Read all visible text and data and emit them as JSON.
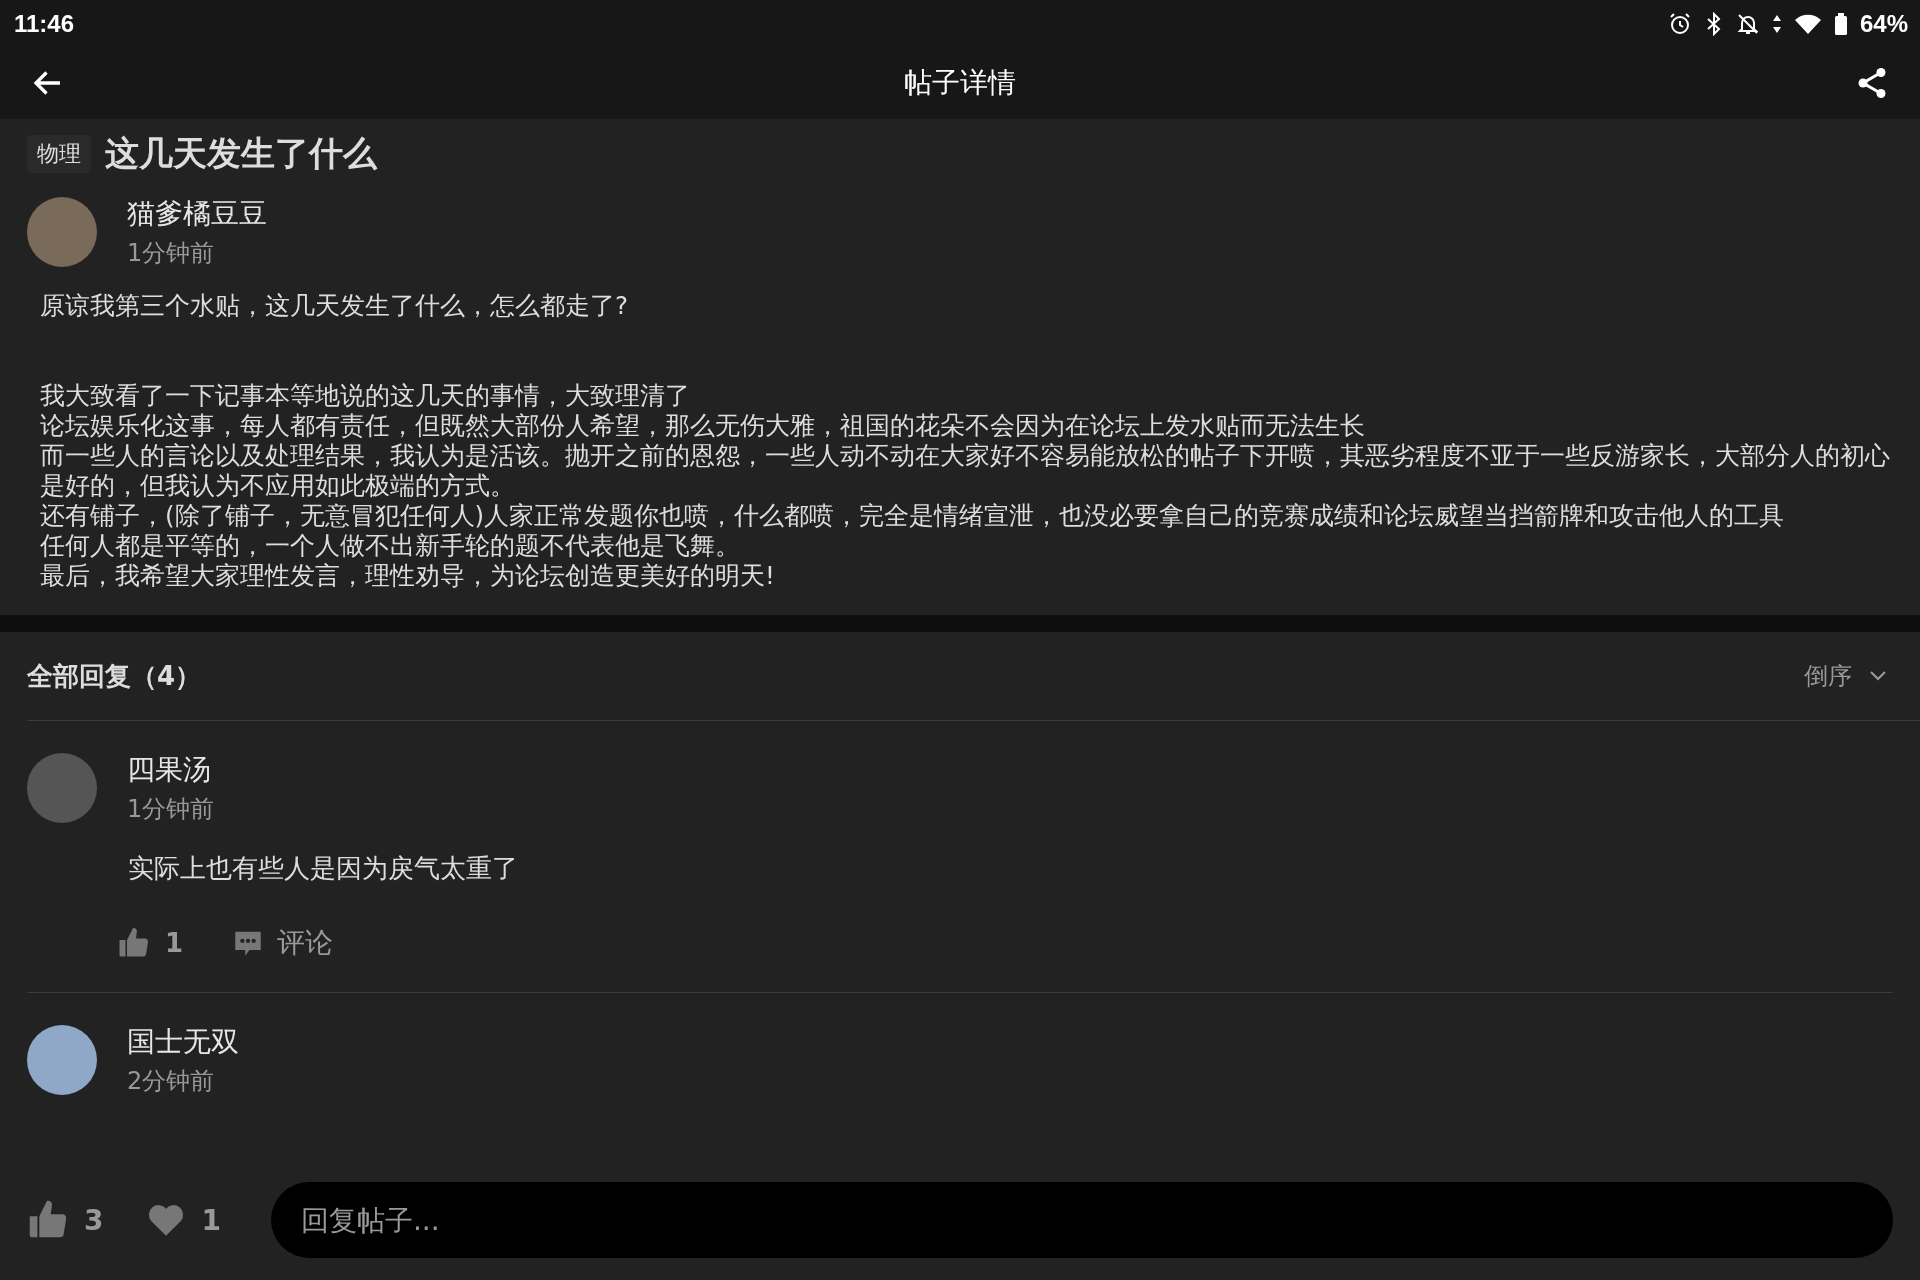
{
  "status_bar": {
    "time": "11:46",
    "battery": "64%"
  },
  "header": {
    "title": "帖子详情"
  },
  "post": {
    "tag": "物理",
    "title": "这几天发生了什么",
    "author": "猫爹橘豆豆",
    "time": "1分钟前",
    "body": [
      "原谅我第三个水贴，这几天发生了什么，怎么都走了?",
      "我大致看了一下记事本等地说的这几天的事情，大致理清了",
      "论坛娱乐化这事，每人都有责任，但既然大部份人希望，那么无伤大雅，祖国的花朵不会因为在论坛上发水贴而无法生长",
      "而一些人的言论以及处理结果，我认为是活该。抛开之前的恩怨，一些人动不动在大家好不容易能放松的帖子下开喷，其恶劣程度不亚于一些反游家长，大部分人的初心是好的，但我认为不应用如此极端的方式。",
      "还有铺子，(除了铺子，无意冒犯任何人)人家正常发题你也喷，什么都喷，完全是情绪宣泄，也没必要拿自己的竞赛成绩和论坛威望当挡箭牌和攻击他人的工具",
      "任何人都是平等的，一个人做不出新手轮的题不代表他是飞舞。",
      "最后，我希望大家理性发言，理性劝导，为论坛创造更美好的明天!"
    ]
  },
  "replies": {
    "title": "全部回复（4）",
    "sort": "倒序",
    "items": [
      {
        "author": "四果汤",
        "time": "1分钟前",
        "content": "实际上也有些人是因为戾气太重了",
        "likes": "1",
        "comment_label": "评论"
      },
      {
        "author": "国士无双",
        "time": "2分钟前"
      }
    ]
  },
  "bottom_bar": {
    "likes": "3",
    "favorites": "1",
    "reply_placeholder": "回复帖子..."
  }
}
